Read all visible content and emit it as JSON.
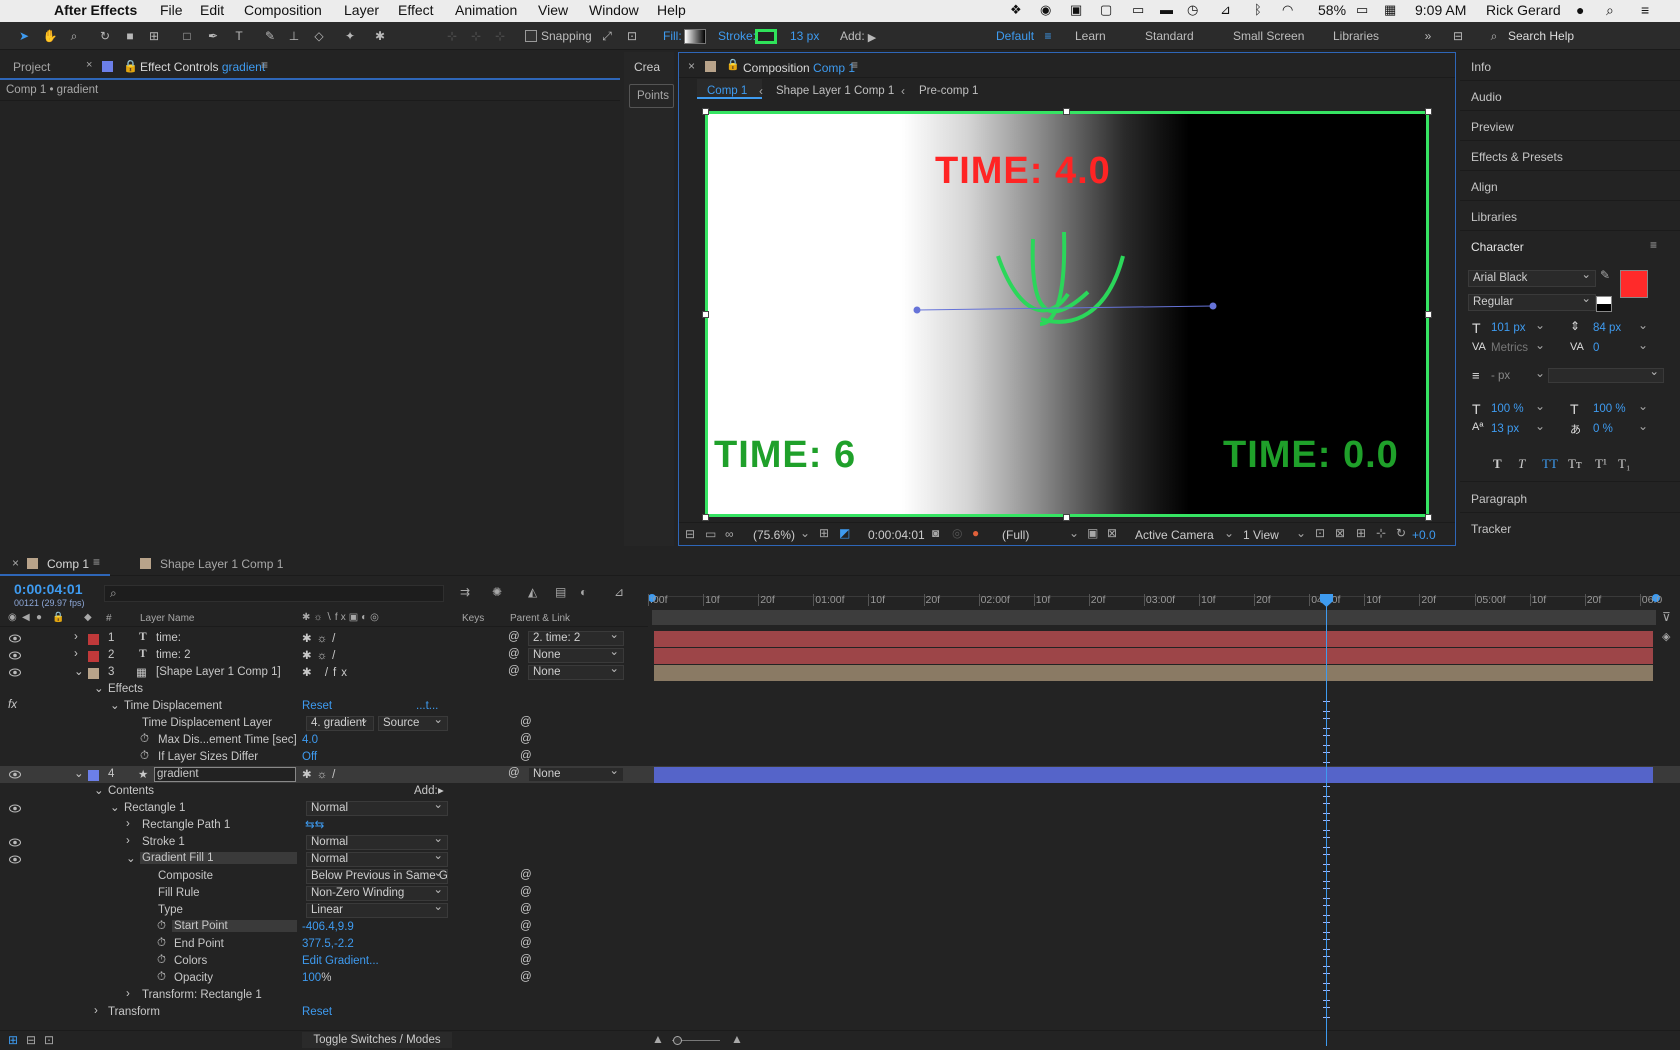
{
  "menubar": {
    "app": "After Effects",
    "items": [
      "File",
      "Edit",
      "Composition",
      "Layer",
      "Effect",
      "Animation",
      "View",
      "Window",
      "Help"
    ],
    "battery": "58%",
    "clock": "9:09 AM",
    "user": "Rick Gerard"
  },
  "toolbar": {
    "snapping": "Snapping",
    "fill": "Fill:",
    "stroke": "Stroke:",
    "stroke_px": "13 px",
    "add": "Add:",
    "workspaces": [
      "Default",
      "Learn",
      "Standard",
      "Small Screen",
      "Libraries"
    ],
    "search": "Search Help"
  },
  "left_panel": {
    "tab_project": "Project",
    "tab_effect_controls": "Effect Controls",
    "effect_controls_layer": "gradient",
    "breadcrumb": "Comp 1 • gradient"
  },
  "narrow_panel": {
    "tab": "Crea",
    "button": "Points"
  },
  "composition": {
    "tab_prefix": "Composition",
    "tab_name": "Comp 1",
    "breadcrumbs": [
      "Comp 1",
      "Shape Layer 1 Comp 1",
      "Pre-comp 1"
    ],
    "text_top": "TIME: 4.0",
    "text_left": "TIME: 6",
    "text_right": "TIME: 0.0",
    "zoom": "(75.6%)",
    "timecode": "0:00:04:01",
    "resolution": "(Full)",
    "camera": "Active Camera",
    "views": "1 View",
    "exposure": "+0.0"
  },
  "right_panel": {
    "items": [
      "Info",
      "Audio",
      "Preview",
      "Effects & Presets",
      "Align",
      "Libraries"
    ],
    "character_title": "Character",
    "font": "Arial Black",
    "style": "Regular",
    "font_size": "101 px",
    "leading": "84 px",
    "kerning": "Metrics",
    "tracking": "0",
    "stroke_width_unit": "- px",
    "vert_scale": "100 %",
    "horiz_scale": "100 %",
    "baseline": "13 px",
    "tsume": "0 %",
    "text_styles": [
      "T",
      "T",
      "TT",
      "Tт",
      "T¹",
      "T₁"
    ],
    "paragraph": "Paragraph",
    "tracker": "Tracker",
    "fill_color": "#ff2a2a"
  },
  "timeline": {
    "tabs": [
      "Comp 1",
      "Shape Layer 1 Comp 1"
    ],
    "timecode": "0:00:04:01",
    "fps_info": "00121 (29.97 fps)",
    "col_hash": "#",
    "col_layer_name": "Layer Name",
    "col_keys": "Keys",
    "col_parent": "Parent & Link",
    "ruler": [
      ":00f",
      "10f",
      "20f",
      "01:00f",
      "10f",
      "20f",
      "02:00f",
      "10f",
      "20f",
      "03:00f",
      "10f",
      "20f",
      "04:00f",
      "10f",
      "20f",
      "05:00f",
      "10f",
      "20f",
      "06:0"
    ],
    "layers": [
      {
        "num": "1",
        "name": "time:",
        "parent": "2. time: 2",
        "color": "#c0393a"
      },
      {
        "num": "2",
        "name": "time: 2",
        "parent": "None",
        "color": "#c0393a"
      },
      {
        "num": "3",
        "name": "[Shape Layer 1 Comp 1]",
        "parent": "None",
        "color": "#b8a38a"
      },
      {
        "num": "4",
        "name": "gradient",
        "parent": "None",
        "color": "#6c7fe8"
      }
    ],
    "effects_label": "Effects",
    "fx": "fx",
    "time_displacement": {
      "label": "Time Displacement",
      "reset": "Reset",
      "dots": "...t...",
      "layer_label": "Time Displacement Layer",
      "layer_value": "4. gradient",
      "source": "Source",
      "max_label": "Max Dis...ement Time [sec]",
      "max_value": "4.0",
      "sizes_label": "If Layer Sizes Differ",
      "sizes_value": "Off"
    },
    "contents": "Contents",
    "add": "Add:",
    "rectangle": {
      "label": "Rectangle 1",
      "mode": "Normal",
      "path": "Rectangle Path 1",
      "stroke": "Stroke 1",
      "stroke_mode": "Normal",
      "gradient_fill": "Gradient Fill 1",
      "gradient_mode": "Normal"
    },
    "gradient": {
      "composite_label": "Composite",
      "composite_value": "Below Previous in Same G",
      "fill_rule_label": "Fill Rule",
      "fill_rule_value": "Non-Zero Winding",
      "type_label": "Type",
      "type_value": "Linear",
      "start_label": "Start Point",
      "start_value": "-406.4,9.9",
      "end_label": "End Point",
      "end_value": "377.5,-2.2",
      "colors_label": "Colors",
      "colors_value": "Edit Gradient...",
      "opacity_label": "Opacity",
      "opacity_value": "100",
      "opacity_unit": "%"
    },
    "transform_rect": "Transform: Rectangle 1",
    "transform": "Transform",
    "transform_reset": "Reset",
    "toggle": "Toggle Switches / Modes"
  }
}
